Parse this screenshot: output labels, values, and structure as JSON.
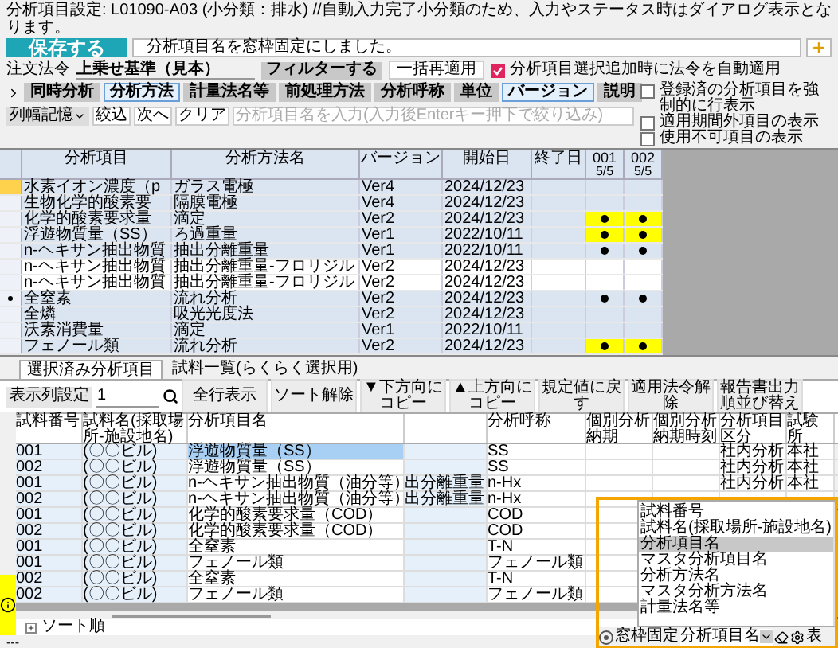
{
  "info": "分析項目設定: L01090-A03 (小分類：排水) //自動入力完了小分類のため、入力やステータス時はダイアログ表示となります。",
  "save_button": "保存する",
  "message": "分析項目名を窓枠固定にしました。",
  "order": {
    "label": "注文法令",
    "value": "上乗せ基準（見本）"
  },
  "filter_button": "フィルターする",
  "reapply_button": "一括再適用",
  "auto_apply": {
    "label": "分析項目選択追加時に法令を自動適用",
    "checked": true
  },
  "toggles": [
    {
      "label": "同時分析",
      "selected": false
    },
    {
      "label": "分析方法",
      "selected": true
    },
    {
      "label": "計量法名等",
      "selected": false
    },
    {
      "label": "前処理方法",
      "selected": false
    },
    {
      "label": "分析呼称",
      "selected": false
    },
    {
      "label": "単位",
      "selected": false
    },
    {
      "label": "バージョン",
      "selected": true
    },
    {
      "label": "説明",
      "selected": false
    }
  ],
  "search": {
    "width_memory": "列幅記憶",
    "buttons": [
      "絞込",
      "次へ",
      "クリア"
    ],
    "placeholder": "分析項目名を入力(入力後Enterキー押下で絞り込み)"
  },
  "display_options": [
    {
      "label": "登録済の分析項目を強制的に行表示",
      "checked": false
    },
    {
      "label": "適用期間外項目の表示",
      "checked": false
    },
    {
      "label": "使用不可項目の表示",
      "checked": false
    }
  ],
  "upper_grid": {
    "columns": [
      "分析項目",
      "分析方法名",
      "バージョン",
      "開始日",
      "終了日"
    ],
    "samples": [
      {
        "id": "001",
        "count": "5/5"
      },
      {
        "id": "002",
        "count": "5/5"
      }
    ],
    "rows": [
      {
        "item": "水素イオン濃度（p",
        "method": "ガラス電極",
        "version": "Ver4",
        "start": "2024/12/23",
        "flag": true,
        "current": false,
        "active": true,
        "warning": false,
        "dots": [
          false,
          false
        ]
      },
      {
        "item": "生物化学的酸素要",
        "method": "隔膜電極",
        "version": "Ver4",
        "start": "2024/12/23",
        "flag": false,
        "current": false,
        "active": true,
        "warning": false,
        "dots": [
          false,
          false
        ]
      },
      {
        "item": "化学的酸素要求量",
        "method": "滴定",
        "version": "Ver2",
        "start": "2024/12/23",
        "flag": false,
        "current": false,
        "active": true,
        "warning": true,
        "dots": [
          true,
          true
        ]
      },
      {
        "item": "浮遊物質量（SS）",
        "method": "ろ過重量",
        "version": "Ver1",
        "start": "2022/10/11",
        "flag": false,
        "current": false,
        "active": true,
        "warning": true,
        "dots": [
          true,
          true
        ]
      },
      {
        "item": "n-ヘキサン抽出物質",
        "method": "抽出分離重量",
        "version": "Ver1",
        "start": "2022/10/11",
        "flag": false,
        "current": false,
        "active": true,
        "warning": false,
        "dots": [
          true,
          true
        ]
      },
      {
        "item": "n-ヘキサン抽出物質",
        "method": "抽出分離重量-フロリジル",
        "version": "Ver2",
        "start": "2024/12/23",
        "flag": false,
        "current": false,
        "active": false,
        "warning": false,
        "dots": [
          false,
          false
        ]
      },
      {
        "item": "n-ヘキサン抽出物質",
        "method": "抽出分離重量-フロリジル",
        "version": "Ver2",
        "start": "2024/12/23",
        "flag": false,
        "current": false,
        "active": false,
        "warning": false,
        "dots": [
          false,
          false
        ]
      },
      {
        "item": "全窒素",
        "method": "流れ分析",
        "version": "Ver2",
        "start": "2024/12/23",
        "flag": false,
        "current": true,
        "active": true,
        "warning": false,
        "dots": [
          true,
          true
        ]
      },
      {
        "item": "全燐",
        "method": "吸光光度法",
        "version": "Ver2",
        "start": "2024/12/23",
        "flag": false,
        "current": false,
        "active": true,
        "warning": false,
        "dots": [
          false,
          false
        ]
      },
      {
        "item": "沃素消費量",
        "method": "滴定",
        "version": "Ver1",
        "start": "2022/10/11",
        "flag": false,
        "current": false,
        "active": true,
        "warning": false,
        "dots": [
          false,
          false
        ]
      },
      {
        "item": "フェノール類",
        "method": "流れ分析",
        "version": "Ver2",
        "start": "2024/12/23",
        "flag": false,
        "current": false,
        "active": true,
        "warning": true,
        "dots": [
          true,
          true
        ]
      }
    ]
  },
  "tabs": [
    {
      "label": "選択済み分析項目",
      "selected": true
    },
    {
      "label": "試料一覧(らくらく選択用)",
      "selected": false
    }
  ],
  "toolbar": {
    "column_settings": "表示列設定",
    "filter_value": "1",
    "buttons": [
      "全行表示",
      "ソート解除",
      "▼下方向にコピー",
      "▲上方向にコピー",
      "規定値に戻す",
      "適用法令解除",
      "報告書出力順並び替え"
    ]
  },
  "lower_grid": {
    "columns": [
      {
        "label": "試料番号"
      },
      {
        "label": "試料名(採取場所-施設地名)"
      },
      {
        "label": "分析項目名"
      },
      {},
      {
        "label": "分析呼称"
      },
      {
        "label": "個別分析納期"
      },
      {
        "label": "個別分析納期時刻"
      },
      {
        "label": "分析項目区分"
      },
      {
        "label": "試験所"
      }
    ],
    "rows": [
      {
        "selected": true,
        "cells": [
          "001",
          "(〇〇ビル)",
          "浮遊物質量（SS）",
          null,
          "SS",
          null,
          null,
          "社内分析",
          "本社"
        ]
      },
      {
        "selected": false,
        "cells": [
          "002",
          "(〇〇ビル)",
          "浮遊物質量（SS）",
          null,
          "SS",
          null,
          null,
          "社内分析",
          "本社"
        ]
      },
      {
        "selected": false,
        "cells": [
          "001",
          "(〇〇ビル)",
          "n-ヘキサン抽出物質（油分等）",
          "出分離重量",
          "n-Hx",
          null,
          null,
          "社内分析",
          "本社"
        ]
      },
      {
        "selected": false,
        "cells": [
          "002",
          "(〇〇ビル)",
          "n-ヘキサン抽出物質（油分等）",
          "出分離重量",
          "n-Hx",
          null,
          null,
          null,
          null
        ]
      },
      {
        "selected": false,
        "cells": [
          "001",
          "(〇〇ビル)",
          "化学的酸素要求量（COD）",
          null,
          "COD",
          null,
          null,
          null,
          null
        ]
      },
      {
        "selected": false,
        "cells": [
          "002",
          "(〇〇ビル)",
          "化学的酸素要求量（COD）",
          null,
          "COD",
          null,
          null,
          null,
          null
        ]
      },
      {
        "selected": false,
        "cells": [
          "001",
          "(〇〇ビル)",
          "全窒素",
          null,
          "T-N",
          null,
          null,
          null,
          null
        ]
      },
      {
        "selected": false,
        "cells": [
          "001",
          "(〇〇ビル)",
          "フェノール類",
          null,
          "フェノール類",
          null,
          null,
          null,
          null
        ]
      },
      {
        "selected": false,
        "cells": [
          "002",
          "(〇〇ビル)",
          "全窒素",
          null,
          "T-N",
          null,
          null,
          null,
          null
        ]
      },
      {
        "selected": false,
        "cells": [
          "002",
          "(〇〇ビル)",
          "フェノール類",
          null,
          "フェノール類",
          null,
          null,
          null,
          null
        ]
      }
    ]
  },
  "column_popup": {
    "items": [
      {
        "label": "試料番号",
        "selected": false
      },
      {
        "label": "試料名(採取場所-施設地名)",
        "selected": false
      },
      {
        "label": "分析項目名",
        "selected": true
      },
      {
        "label": "マスタ分析項目名",
        "selected": false
      },
      {
        "label": "分析方法名",
        "selected": false
      },
      {
        "label": "マスタ分析方法名",
        "selected": false
      },
      {
        "label": "計量法名等",
        "selected": false
      }
    ],
    "freeze_label": "窓枠固定",
    "freeze_value": "分析項目名",
    "show_label": "表"
  },
  "sort_order": "ソート順",
  "status": "---"
}
